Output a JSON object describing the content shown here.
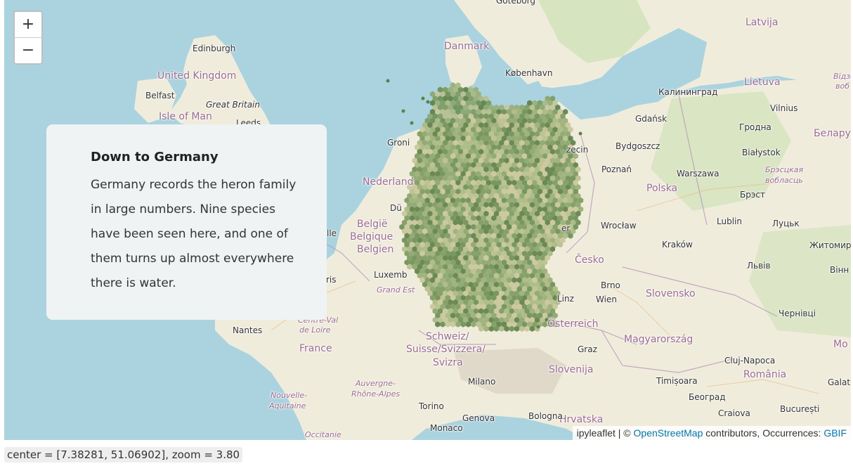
{
  "zoom_control": {
    "zoom_in": "+",
    "zoom_out": "−"
  },
  "info_card": {
    "title": "Down to Germany",
    "body": "Germany records the heron family in large numbers. Nine species have been seen here, and one of them turns up almost everywhere there is water."
  },
  "attribution": {
    "prefix": "ipyleaflet | © ",
    "osm": "OpenStreetMap",
    "middle": " contributors, Occurrences: ",
    "gbif": "GBIF"
  },
  "status_text": "center = [7.38281, 51.06902], zoom = 3.80",
  "colors": {
    "water": "#aad3df",
    "land": "#f0ecdc",
    "hex_dark": "#6f8f55",
    "hex_light": "#c9c59a"
  },
  "map_labels": {
    "goteborg": "Göteborg",
    "latvija": "Latvija",
    "edinburgh": "Edinburgh",
    "danmark": "Danmark",
    "united_kingdom": "United Kingdom",
    "kobenhavn": "København",
    "vidzeme": "Відзе",
    "vob": "воб",
    "lietuva": "Lietuva",
    "belfast": "Belfast",
    "kaliningrad": "Калининград",
    "great_britain": "Great Britain",
    "vilnius": "Vilnius",
    "isle_of_man": "Isle of Man",
    "leeds": "Leeds",
    "gdansk": "Gdańsk",
    "grodna": "Гродна",
    "belarus": "Белару",
    "groningen": "Groni",
    "szczecin": "zecin",
    "bydgoszcz": "Bydgoszcz",
    "bialystok": "Białystok",
    "poznan": "Poznań",
    "warszawa": "Warszawa",
    "brest_region": "Брэсцкая",
    "voblasc": "вобласць",
    "nederland": "Nederland",
    "polska": "Polska",
    "brest": "Брэст",
    "dusseldorf": "Dü",
    "wroclaw": "Wrocław",
    "lublin": "Lublin",
    "lutsk": "Луцьк",
    "lille": "lle",
    "belgie": "België",
    "belgique": "Belgique",
    "belgien": "Belgien",
    "berlin_area": "er",
    "krakow": "Kraków",
    "zhytomyr": "Житомир",
    "luxemb": "Luxemb",
    "cesko": "Česko",
    "lviv": "Львів",
    "vinn": "Вінн",
    "paris": "ris",
    "grand_est": "Grand Est",
    "brno": "Brno",
    "linz": "Linz",
    "wien": "Wien",
    "slovensko": "Slovensko",
    "chernivtsi": "Чернівці",
    "centre_val": "Centre-Val",
    "de_loire": "de Loire",
    "nantes": "Nantes",
    "osterreich": "Österreich",
    "schweiz": "Schweiz/",
    "suisse": "Suisse/Svizzera/",
    "magyarorszag": "Magyarország",
    "mo": "Mo",
    "france": "France",
    "graz": "Graz",
    "svizra": "Svizra",
    "cluj": "Cluj-Napoca",
    "slovenija": "Slovenija",
    "romania": "România",
    "milano": "Milano",
    "timisoara": "Timișoara",
    "galat": "Galat",
    "auvergne": "Auvergne-",
    "rhone": "Rhône-Alpes",
    "nouvelle": "Nouvelle-",
    "aquitaine": "Aquitaine",
    "beograd": "Београд",
    "torino": "Torino",
    "hrvatska": "Hrvatska",
    "craiova": "Craiova",
    "bucuresti": "București",
    "genova": "Genova",
    "bologna": "Bologna",
    "monaco": "Monaco",
    "occitanie": "Occitanie"
  }
}
